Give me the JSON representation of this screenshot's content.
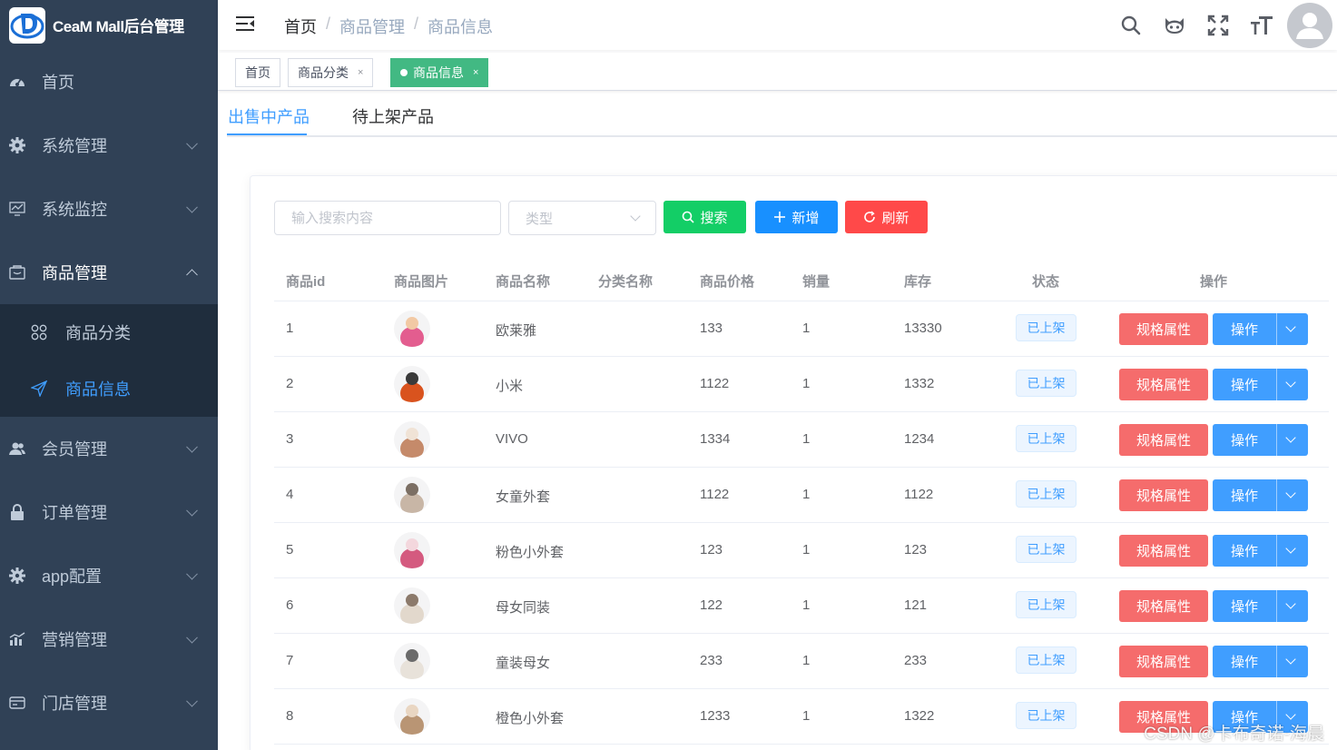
{
  "app": {
    "title": "CeaM Mall后台管理"
  },
  "sidebar": {
    "items": [
      {
        "label": "首页",
        "icon": "dashboard-icon",
        "expandable": false
      },
      {
        "label": "系统管理",
        "icon": "gear-icon",
        "expandable": true
      },
      {
        "label": "系统监控",
        "icon": "monitor-icon",
        "expandable": true
      },
      {
        "label": "商品管理",
        "icon": "goods-icon",
        "expandable": true,
        "open": true
      },
      {
        "label": "会员管理",
        "icon": "users-icon",
        "expandable": true
      },
      {
        "label": "订单管理",
        "icon": "lock-icon",
        "expandable": true
      },
      {
        "label": "app配置",
        "icon": "cog-icon",
        "expandable": true
      },
      {
        "label": "营销管理",
        "icon": "chart-icon",
        "expandable": true
      },
      {
        "label": "门店管理",
        "icon": "store-icon",
        "expandable": true
      }
    ],
    "submenu": [
      {
        "label": "商品分类",
        "icon": "category-icon"
      },
      {
        "label": "商品信息",
        "icon": "send-icon",
        "active": true
      }
    ]
  },
  "breadcrumb": [
    "首页",
    "商品管理",
    "商品信息"
  ],
  "tags": [
    {
      "label": "首页"
    },
    {
      "label": "商品分类",
      "close": "×"
    },
    {
      "label": "商品信息",
      "close": "×",
      "active": true
    }
  ],
  "tabs": [
    "出售中产品",
    "待上架产品"
  ],
  "search": {
    "placeholder": "输入搜索内容",
    "type_placeholder": "类型"
  },
  "buttons": {
    "search": "搜索",
    "add": "新增",
    "refresh": "刷新"
  },
  "colors": {
    "sidebar": "#304156",
    "accent": "#409eff",
    "success": "#13ce66",
    "danger": "#f56c6c",
    "tag_active": "#42b983"
  },
  "table": {
    "headers": [
      "商品id",
      "商品图片",
      "商品名称",
      "分类名称",
      "商品价格",
      "销量",
      "库存",
      "状态",
      "操作"
    ],
    "rows": [
      {
        "id": "1",
        "name": "欧莱雅",
        "category": "",
        "price": "133",
        "sales": "1",
        "stock": "13330",
        "status": "已上架",
        "spec": "规格属性",
        "op": "操作"
      },
      {
        "id": "2",
        "name": "小米",
        "category": "",
        "price": "1122",
        "sales": "1",
        "stock": "1332",
        "status": "已上架",
        "spec": "规格属性",
        "op": "操作"
      },
      {
        "id": "3",
        "name": "VIVO",
        "category": "",
        "price": "1334",
        "sales": "1",
        "stock": "1234",
        "status": "已上架",
        "spec": "规格属性",
        "op": "操作"
      },
      {
        "id": "4",
        "name": "女童外套",
        "category": "",
        "price": "1122",
        "sales": "1",
        "stock": "1122",
        "status": "已上架",
        "spec": "规格属性",
        "op": "操作"
      },
      {
        "id": "5",
        "name": "粉色小外套",
        "category": "",
        "price": "123",
        "sales": "1",
        "stock": "123",
        "status": "已上架",
        "spec": "规格属性",
        "op": "操作"
      },
      {
        "id": "6",
        "name": "母女同装",
        "category": "",
        "price": "122",
        "sales": "1",
        "stock": "121",
        "status": "已上架",
        "spec": "规格属性",
        "op": "操作"
      },
      {
        "id": "7",
        "name": "童装母女",
        "category": "",
        "price": "233",
        "sales": "1",
        "stock": "233",
        "status": "已上架",
        "spec": "规格属性",
        "op": "操作"
      },
      {
        "id": "8",
        "name": "橙色小外套",
        "category": "",
        "price": "1233",
        "sales": "1",
        "stock": "1322",
        "status": "已上架",
        "spec": "规格属性",
        "op": "操作"
      }
    ]
  },
  "watermark": "CSDN @卡布奇诺-海晨"
}
